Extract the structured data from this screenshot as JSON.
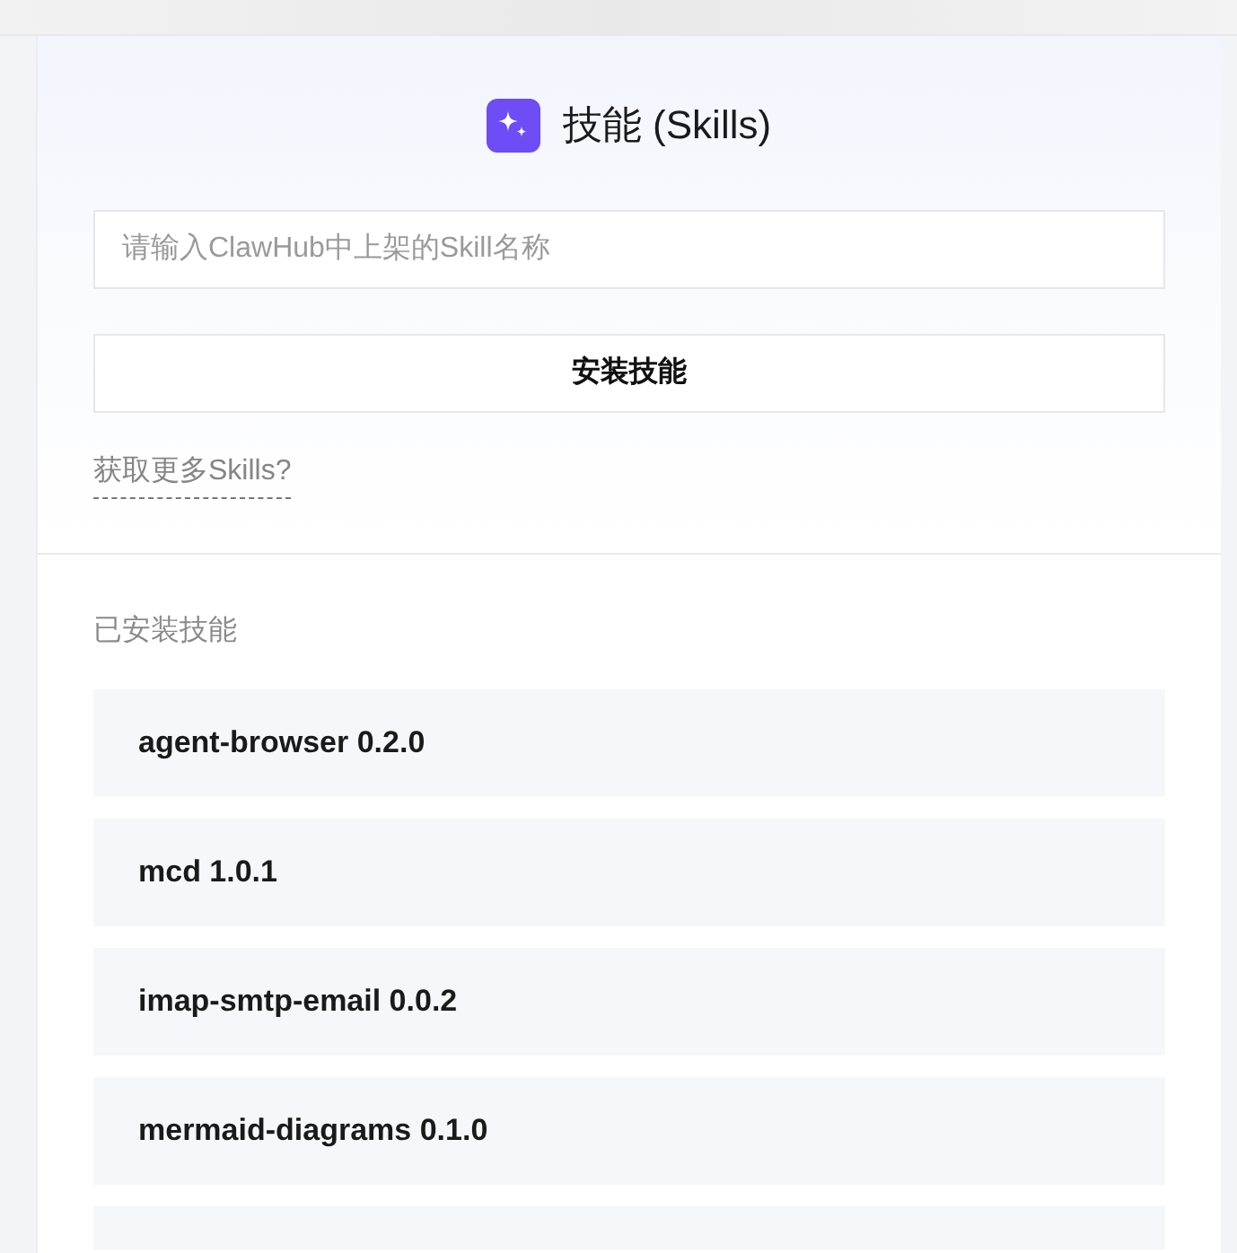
{
  "header": {
    "title": "技能 (Skills)"
  },
  "install": {
    "input": {
      "placeholder": "请输入ClawHub中上架的Skill名称"
    },
    "button": "安装技能",
    "more_link": "获取更多Skills?"
  },
  "installed": {
    "heading": "已安装技能",
    "skills": [
      {
        "name": "agent-browser 0.2.0"
      },
      {
        "name": "mcd 1.0.1"
      },
      {
        "name": "imap-smtp-email 0.0.2"
      },
      {
        "name": "mermaid-diagrams 0.1.0"
      }
    ],
    "more_rows_below": true
  }
}
